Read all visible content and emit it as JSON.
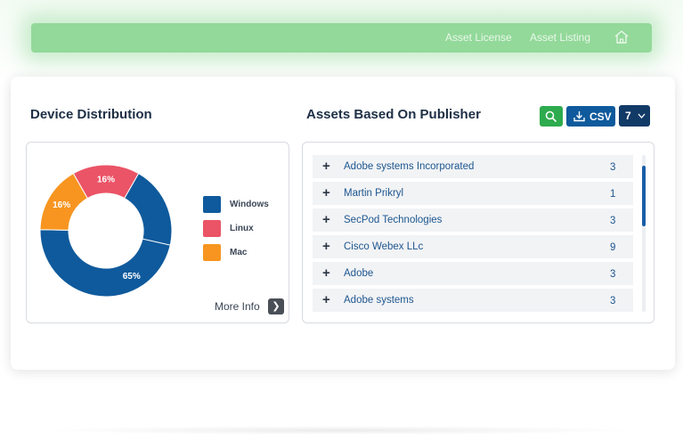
{
  "breadcrumb": {
    "items": [
      {
        "label": "Asset License"
      },
      {
        "label": "Asset Listing"
      }
    ],
    "home_icon": "home-icon"
  },
  "device_distribution": {
    "title": "Device Distribution",
    "more_info_label": "More Info",
    "more_info_icon": "chevron-right-icon",
    "chart_data": {
      "type": "pie",
      "categories": [
        "Windows",
        "Linux",
        "Mac"
      ],
      "values": [
        65,
        16,
        16
      ],
      "labels": [
        "65%",
        "16%",
        "16%"
      ],
      "colors": [
        "#0f5a9c",
        "#ea5466",
        "#f79520"
      ],
      "legend": "right"
    }
  },
  "publishers": {
    "title": "Assets Based On Publisher",
    "search_icon": "search-icon",
    "csv_label": "CSV",
    "csv_icon": "download-icon",
    "page_size": "7",
    "page_size_icon": "chevron-down-icon",
    "rows": [
      {
        "name": "Adobe systems Incorporated",
        "count": "3"
      },
      {
        "name": "Martin Prikryl",
        "count": "1"
      },
      {
        "name": "SecPod Technologies",
        "count": "3"
      },
      {
        "name": "Cisco Webex LLc",
        "count": "9"
      },
      {
        "name": "Adobe",
        "count": "3"
      },
      {
        "name": "Adobe systems",
        "count": "3"
      }
    ],
    "expand_symbol": "+"
  }
}
